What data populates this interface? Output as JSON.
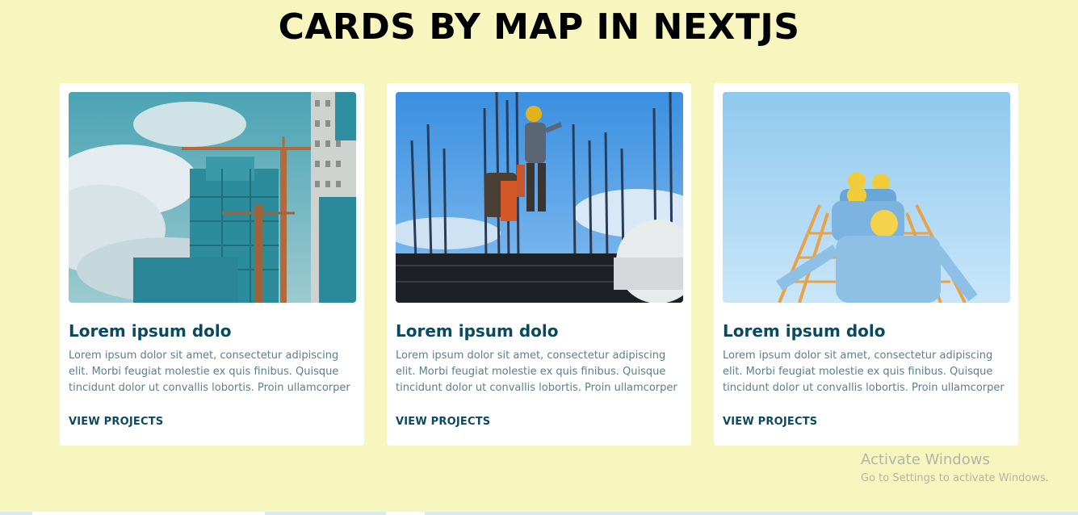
{
  "page": {
    "title": "CARDS BY MAP IN NEXTJS"
  },
  "cards": [
    {
      "image": "construction-buildings-cranes",
      "title": "Lorem ipsum dolo",
      "description": "Lorem ipsum dolor sit amet, consectetur adipiscing elit. Morbi feugiat molestie ex quis finibus. Quisque tincidunt dolor ut convallis lobortis. Proin ullamcorper",
      "link_label": "VIEW PROJECTS"
    },
    {
      "image": "worker-on-rebar-site",
      "title": "Lorem ipsum dolo",
      "description": "Lorem ipsum dolor sit amet, consectetur adipiscing elit. Morbi feugiat molestie ex quis finibus. Quisque tincidunt dolor ut convallis lobortis. Proin ullamcorper",
      "link_label": "VIEW PROJECTS"
    },
    {
      "image": "workers-in-hardhats-sky",
      "title": "Lorem ipsum dolo",
      "description": "Lorem ipsum dolor sit amet, consectetur adipiscing elit. Morbi feugiat molestie ex quis finibus. Quisque tincidunt dolor ut convallis lobortis. Proin ullamcorper",
      "link_label": "VIEW PROJECTS"
    }
  ],
  "watermark": {
    "title": "Activate Windows",
    "subtitle": "Go to Settings to activate Windows."
  },
  "colors": {
    "background": "#f7f6bf",
    "card": "#ffffff",
    "heading": "#0b4a5e",
    "body_text": "#5a7f8f"
  }
}
